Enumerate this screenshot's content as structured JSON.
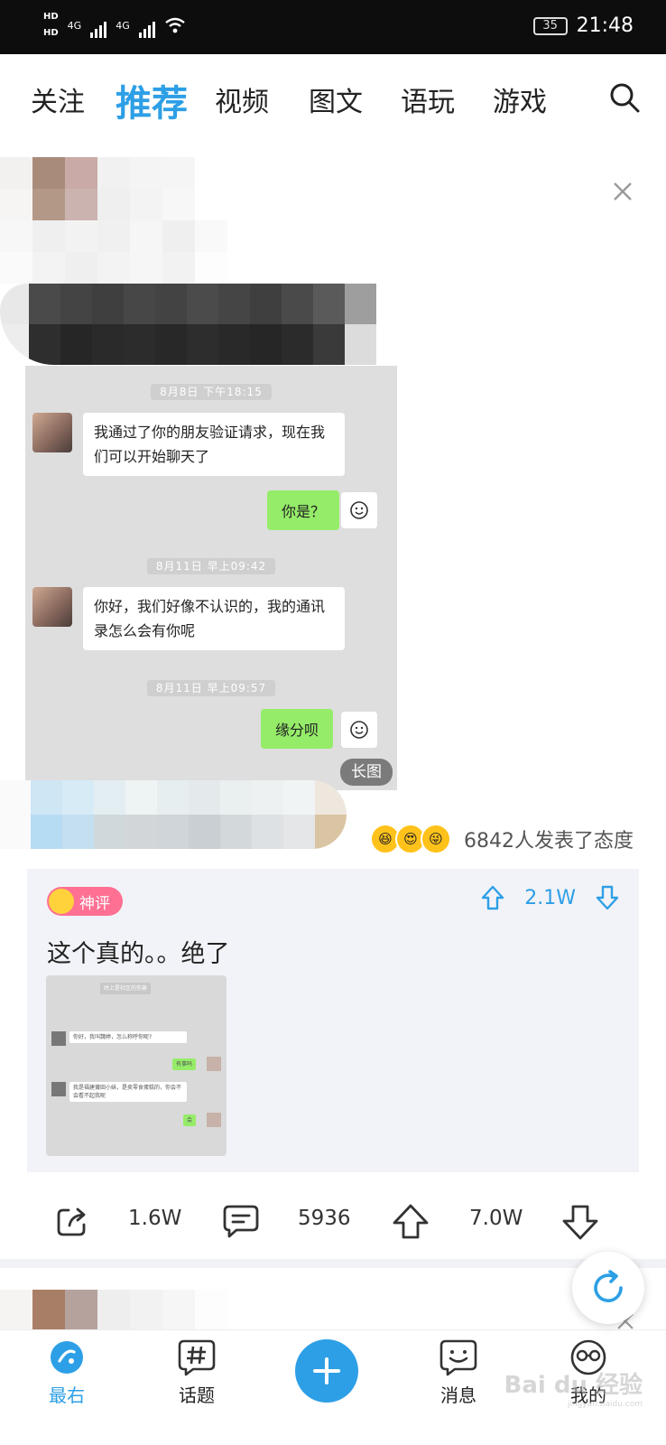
{
  "status_bar": {
    "network_1": "HD",
    "network_2": "HD",
    "signal_1": "4G",
    "signal_2": "4G",
    "battery": "35",
    "time": "21:48"
  },
  "top_tabs": [
    {
      "label": "关注"
    },
    {
      "label": "推荐"
    },
    {
      "label": "视频"
    },
    {
      "label": "图文"
    },
    {
      "label": "语玩"
    },
    {
      "label": "游戏"
    }
  ],
  "post": {
    "chat_screenshot": {
      "time_1": "8月8日 下午18:15",
      "msg_1": "我通过了你的朋友验证请求，现在我们可以开始聊天了",
      "reply_1": "你是？",
      "time_2": "8月11日 早上09:42",
      "msg_2": "你好，我们好像不认识的，我的通讯录怎么会有你呢",
      "time_3": "8月11日 早上09:57",
      "reply_2": "缘分呗",
      "long_image_label": "长图"
    },
    "attitude_text": "6842人发表了态度"
  },
  "god_comment": {
    "badge": "神评",
    "votes": "2.1W",
    "text": "这个真的。。绝了",
    "thumb": {
      "m0": "时上是社区的伤害",
      "m1": "你好，我叫魏婷，怎么称呼你呢?",
      "m2": "有事吗",
      "m3": "我是福建莆田小妹，是卖零食蛋糕的，你会不会看不起我呢",
      "m4": "会"
    }
  },
  "actions": {
    "share_count": "1.6W",
    "comment_count": "5936",
    "like_count": "7.0W"
  },
  "bottom_nav": [
    {
      "label": "最右"
    },
    {
      "label": "话题"
    },
    {
      "label": "消息"
    },
    {
      "label": "我的"
    }
  ],
  "watermark": {
    "brand": "Bai du 经验",
    "url": "jingyan.baidu.com"
  },
  "colors": {
    "accent": "#2d9fe6",
    "wechat_green": "#95ec69",
    "god_badge": "#ff7093"
  }
}
